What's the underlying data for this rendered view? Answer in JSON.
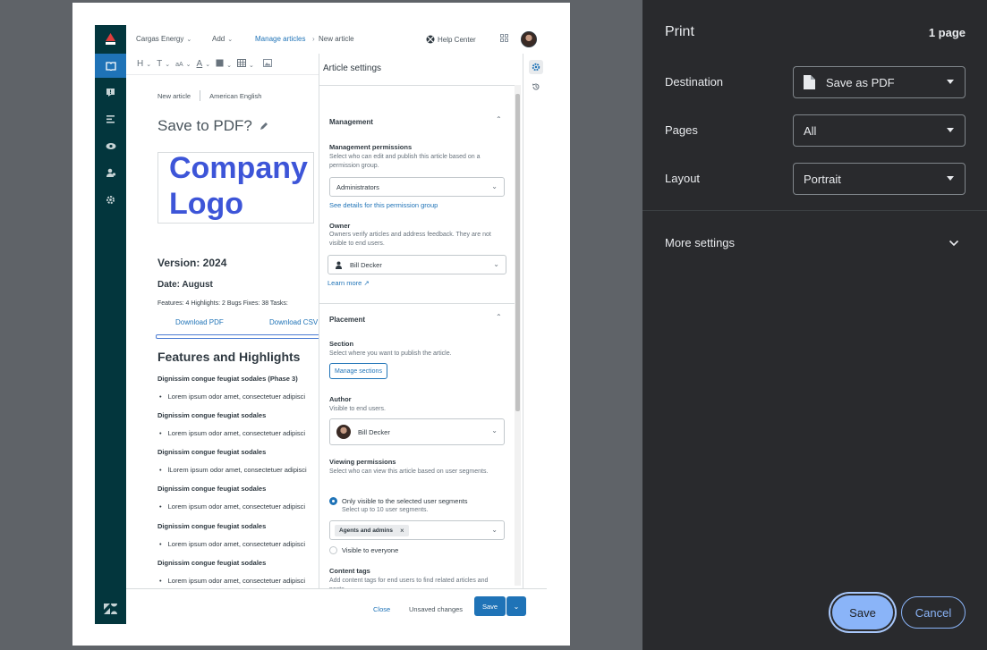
{
  "topbar": {
    "brand": "Cargas Energy",
    "add": "Add",
    "breadcrumb_parent": "Manage articles",
    "breadcrumb_sep": "›",
    "breadcrumb_current": "New article",
    "help": "Help Center"
  },
  "toolbar": {
    "heading": "H",
    "text": "T",
    "size": "aA",
    "color": "A"
  },
  "editor": {
    "meta_left": "New article",
    "meta_right": "American English",
    "title": "Save to PDF?",
    "logo_line1": "Company",
    "logo_line2": "Logo",
    "version": "Version: 2024",
    "date": "Date: August",
    "stats": "Features: 4   Highlights: 2   Bugs Fixes: 38   Tasks:",
    "download_pdf": "Download PDF",
    "download_csv": "Download CSV",
    "features_heading": "Features and Highlights",
    "sections": [
      {
        "heading": "Dignissim congue feugiat sodales (Phase 3)",
        "item": "Lorem ipsum odor amet, consectetuer adipisci"
      },
      {
        "heading": "Dignissim congue feugiat sodales",
        "item": "Lorem ipsum odor amet, consectetuer adipisci"
      },
      {
        "heading": "Dignissim congue feugiat sodales",
        "item": "lLorem ipsum odor amet, consectetuer adipisci"
      },
      {
        "heading": "Dignissim congue feugiat sodales",
        "item": "Lorem ipsum odor amet, consectetuer adipisci"
      },
      {
        "heading": "Dignissim congue feugiat sodales",
        "item": "Lorem ipsum odor amet, consectetuer adipisci"
      },
      {
        "heading": "Dignissim congue feugiat sodales",
        "item": "Lorem ipsum odor amet, consectetuer adipisci"
      }
    ]
  },
  "settings": {
    "title": "Article settings",
    "management": {
      "heading": "Management",
      "perm_label": "Management permissions",
      "perm_hint": "Select who can edit and publish this article based on a permission group.",
      "perm_value": "Administrators",
      "perm_link": "See details for this permission group",
      "owner_label": "Owner",
      "owner_hint": "Owners verify articles and address feedback. They are not visible to end users.",
      "owner_value": "Bill Decker",
      "learn_more": "Learn more"
    },
    "placement": {
      "heading": "Placement",
      "section_label": "Section",
      "section_hint": "Select where you want to publish the article.",
      "manage_sections": "Manage sections",
      "author_label": "Author",
      "author_hint": "Visible to end users.",
      "author_value": "Bill Decker",
      "viewing_label": "Viewing permissions",
      "viewing_hint": "Select who can view this article based on user segments.",
      "radio_selected": "Only visible to the selected user segments",
      "radio_selected_hint": "Select up to 10 user segments.",
      "segment_tag": "Agents and admins",
      "radio_everyone": "Visible to everyone",
      "content_tags_label": "Content tags",
      "content_tags_hint": "Add content tags for end users to find related articles and posts."
    }
  },
  "footer": {
    "close": "Close",
    "unsaved": "Unsaved changes",
    "save": "Save"
  },
  "print": {
    "title": "Print",
    "page_count": "1 page",
    "destination_label": "Destination",
    "destination_value": "Save as PDF",
    "pages_label": "Pages",
    "pages_value": "All",
    "layout_label": "Layout",
    "layout_value": "Portrait",
    "more_settings": "More settings",
    "save": "Save",
    "cancel": "Cancel"
  },
  "colors": {
    "rail": "#03363d",
    "accent": "#1f73b7",
    "logo_text": "#3d55d8",
    "dialog_bg": "#292a2d",
    "dialog_button": "#8ab4f8"
  }
}
